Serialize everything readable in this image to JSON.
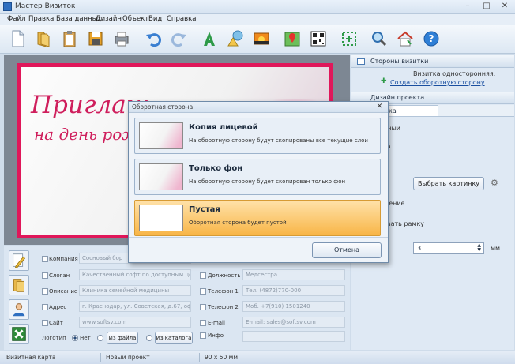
{
  "window": {
    "title": "Мастер Визиток",
    "minimize": "–",
    "maximize": "□",
    "close": "✕"
  },
  "menu": [
    "Файл",
    "Правка",
    "База данных",
    "Дизайн",
    "Объект",
    "Вид",
    "Справка"
  ],
  "toolbar_icons": [
    "new-file-icon",
    "open-folder-icon",
    "clipboard-icon",
    "save-icon",
    "print-icon",
    "undo-icon",
    "redo-icon",
    "text-icon",
    "shapes-icon",
    "image-icon",
    "map-icon",
    "qr-code-icon",
    "crop-icon",
    "zoom-icon",
    "home-icon",
    "help-icon"
  ],
  "card": {
    "line1": "Приглаш",
    "line2": "на день рож"
  },
  "form": {
    "company_label": "Компания",
    "company_value": "Сосновый бор",
    "slogan_label": "Слоган",
    "slogan_value": "Качественный софт по доступным ценам",
    "description_label": "Описание",
    "description_value": "Клиника семейной медицины",
    "address_label": "Адрес",
    "address_value": "г. Краснодар, ул. Советская, д.67, оф.302",
    "site_label": "Сайт",
    "site_value": "www.softsv.com",
    "logo_label": "Логотип",
    "logo_none": "Нет",
    "logo_from_file": "Из файла",
    "logo_from_catalog": "Из каталога",
    "position_label": "Должность",
    "position_value": "Медсестра",
    "phone1_label": "Телефон 1",
    "phone1_value": "Тел. (4872)770-000",
    "phone2_label": "Телефон 2",
    "phone2_value": "Моб. +7(910) 1501240",
    "email_label": "E-mail",
    "email_value": "E-mail: sales@softsv.com",
    "info_label": "Инфо"
  },
  "right_panel": {
    "sides_header": "Стороны визитки",
    "single_sided": "Визитка односторонняя.",
    "create_back": "Создать оборотную сторону",
    "design_header": "Дизайн проекта",
    "tab_partial": "ка",
    "row1": "нный",
    "row2": "та",
    "row3": "й",
    "choose_picture": "Выбрать картинку",
    "row4": "жение",
    "frame": "овать рамку",
    "frame_width": "3",
    "unit": "мм"
  },
  "dialog": {
    "title": "Оборотная сторона",
    "close": "✕",
    "options": [
      {
        "title": "Копия лицевой",
        "desc": "На оборотную сторону будут скопированы все текущие слои"
      },
      {
        "title": "Только фон",
        "desc": "На оборотную сторону будет скопирован только фон"
      },
      {
        "title": "Пустая",
        "desc": "Оборотная сторона будет пустой"
      }
    ],
    "cancel": "Отмена"
  },
  "status": {
    "mode": "Визитная карта",
    "project": "Новый проект",
    "size": "90 x 50 мм"
  }
}
